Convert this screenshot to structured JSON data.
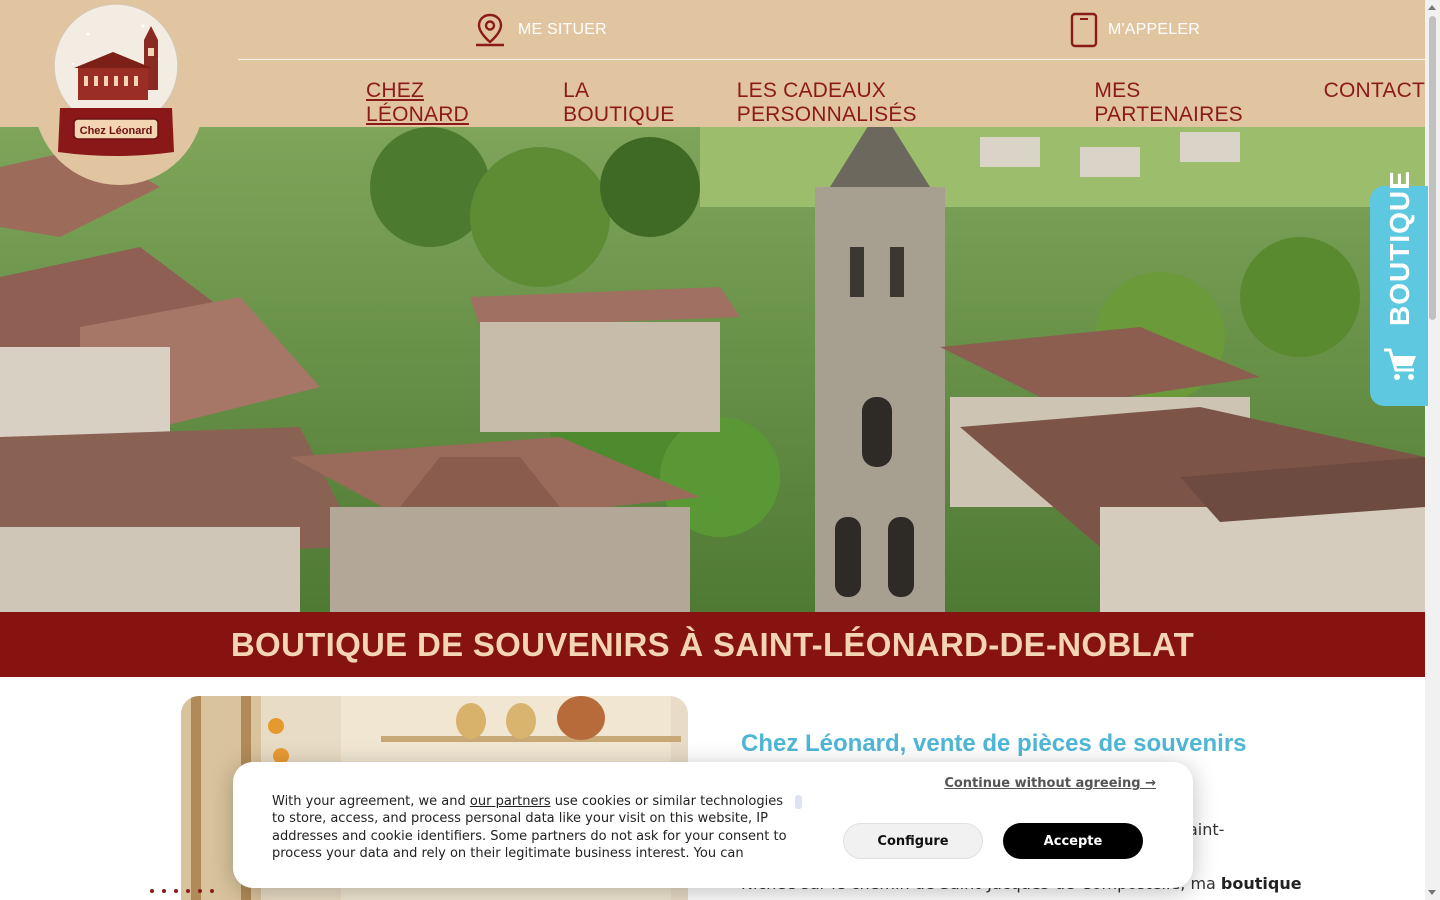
{
  "header": {
    "locate_label": "ME SITUER",
    "call_label": "M'APPELER",
    "logo_text": "Chez Léonard"
  },
  "nav": {
    "items": [
      {
        "label": "CHEZ LÉONARD",
        "active": true
      },
      {
        "label": "LA BOUTIQUE"
      },
      {
        "label": "LES CADEAUX PERSONNALISÉS"
      },
      {
        "label": "MES PARTENAIRES"
      },
      {
        "label": "CONTACT"
      }
    ]
  },
  "side_tab": {
    "label": "BOUTIQUE",
    "color": "#5ec8e0"
  },
  "banner": {
    "title": "BOUTIQUE DE SOUVENIRS À SAINT-LÉONARD-DE-NOBLAT",
    "color": "#86130f"
  },
  "intro": {
    "heading": "Chez Léonard, vente de pièces de souvenirs",
    "fragment": "aint-",
    "line_start": "Nichée sur le chemin de Saint-Jacques-de-Compostelle, ma ",
    "line_bold": "boutique"
  },
  "cookie": {
    "continue_label": "Continue without agreeing →",
    "text_before": "With your agreement, we and ",
    "partners_link": "our partners",
    "text_after": " use cookies or similar technologies to store, access, and process personal data like your visit on this website, IP addresses and cookie identifiers. Some partners do not ask for your consent to process your data and rely on their legitimate business interest. You can",
    "configure_label": "Configure",
    "accept_label": "Accepte"
  },
  "colors": {
    "header_bg": "#e1c4a0",
    "nav_text": "#8b1a1a",
    "heading_blue": "#4fb6d6"
  }
}
